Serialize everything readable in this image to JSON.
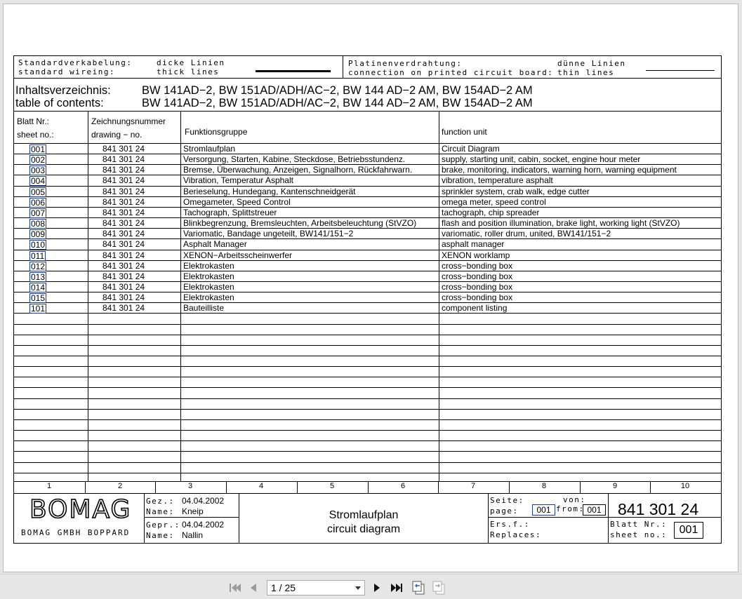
{
  "header": {
    "std_de": "Standardverkabelung:",
    "std_en": "standard wireing:",
    "thick_de": "dicke Linien",
    "thick_en": "thick lines",
    "pcb_de": "Platinenverdrahtung:",
    "pcb_en": "connection on printed circuit board:",
    "thin_de": "dünne Linien",
    "thin_en": "thin lines"
  },
  "title": {
    "label_de": "Inhaltsverzeichnis:",
    "label_en": "table of contents:",
    "models_de": "BW 141AD−2, BW 151AD/ADH/AC−2, BW 144 AD−2 AM, BW 154AD−2 AM",
    "models_en": "BW 141AD−2, BW 151AD/ADH/AC−2, BW 144 AD−2 AM, BW 154AD−2 AM"
  },
  "columns": {
    "sheet_de": "Blatt Nr.:",
    "sheet_en": "sheet no.:",
    "drawing_de": "Zeichnungsnummer",
    "drawing_en": "drawing − no.",
    "group": "Funktionsgruppe",
    "unit": "function unit"
  },
  "rows": [
    {
      "sheet": "001",
      "drawing": "841 301 24",
      "group": "Stromlaufplan",
      "unit": "Circuit Diagram"
    },
    {
      "sheet": "002",
      "drawing": "841 301 24",
      "group": "Versorgung, Starten, Kabine, Steckdose, Betriebsstundenz.",
      "unit": "supply, starting unit, cabin, socket, engine hour meter"
    },
    {
      "sheet": "003",
      "drawing": "841 301 24",
      "group": "Bremse, Überwachung, Anzeigen, Signalhorn, Rückfahrwarn.",
      "unit": "brake, monitoring, indicators, warning horn, warning equipment"
    },
    {
      "sheet": "004",
      "drawing": "841 301 24",
      "group": "Vibration, Temperatur Asphalt",
      "unit": "vibration, temperature asphalt"
    },
    {
      "sheet": "005",
      "drawing": "841 301 24",
      "group": "Berieselung, Hundegang, Kantenschneidgerät",
      "unit": "sprinkler system, crab walk, edge cutter"
    },
    {
      "sheet": "006",
      "drawing": "841 301 24",
      "group": "Omegameter, Speed Control",
      "unit": "omega meter, speed control"
    },
    {
      "sheet": "007",
      "drawing": "841 301 24",
      "group": "Tachograph, Splittstreuer",
      "unit": "tachograph, chip spreader"
    },
    {
      "sheet": "008",
      "drawing": "841 301 24",
      "group": "Blinkbegrenzung, Bremsleuchten, Arbeitsbeleuchtung (StVZO)",
      "unit": "flash and position illumination, brake light, working light (StVZO)"
    },
    {
      "sheet": "009",
      "drawing": "841 301 24",
      "group": "Variomatic, Bandage ungeteilt, BW141/151−2",
      "unit": "variomatic, roller drum, united, BW141/151−2"
    },
    {
      "sheet": "010",
      "drawing": "841 301 24",
      "group": "Asphalt Manager",
      "unit": "asphalt manager"
    },
    {
      "sheet": "011",
      "drawing": "841 301 24",
      "group": "XENON−Arbeitsscheinwerfer",
      "unit": "XENON worklamp"
    },
    {
      "sheet": "012",
      "drawing": "841 301 24",
      "group": "Elektrokasten",
      "unit": "cross−bonding box"
    },
    {
      "sheet": "013",
      "drawing": "841 301 24",
      "group": "Elektrokasten",
      "unit": "cross−bonding box"
    },
    {
      "sheet": "014",
      "drawing": "841 301 24",
      "group": "Elektrokasten",
      "unit": "cross−bonding box"
    },
    {
      "sheet": "015",
      "drawing": "841 301 24",
      "group": "Elektrokasten",
      "unit": "cross−bonding box"
    },
    {
      "sheet": "101",
      "drawing": "841 301 24",
      "group": "Bauteilliste",
      "unit": "component listing"
    }
  ],
  "grid_numbers": [
    "1",
    "2",
    "3",
    "4",
    "5",
    "6",
    "7",
    "8",
    "9",
    "10"
  ],
  "titleblock": {
    "logo": "BOMAG",
    "company": "BOMAG GMBH BOPPARD",
    "drawn_de": "Gez.:",
    "drawn_en": "Name:",
    "drawn_date": "04.04.2002",
    "drawn_name": "Kneip",
    "checked_de": "Gepr.:",
    "checked_en": "Name:",
    "checked_date": "04.04.2002",
    "checked_name": "Nallin",
    "doc_title_de": "Stromlaufplan",
    "doc_title_en": "circuit diagram",
    "page_de": "Seite:",
    "page_en": "page:",
    "page_value": "001",
    "of_de": "von:",
    "of_en": "from:",
    "of_value": "001",
    "drawing_number": "841 301 24",
    "replaces_de": "Ers.f.:",
    "replaces_en": "Replaces:",
    "sheet_de": "Blatt Nr.:",
    "sheet_en": "sheet no.:",
    "sheet_value": "001"
  },
  "viewer": {
    "page_indicator": "1 / 25"
  }
}
